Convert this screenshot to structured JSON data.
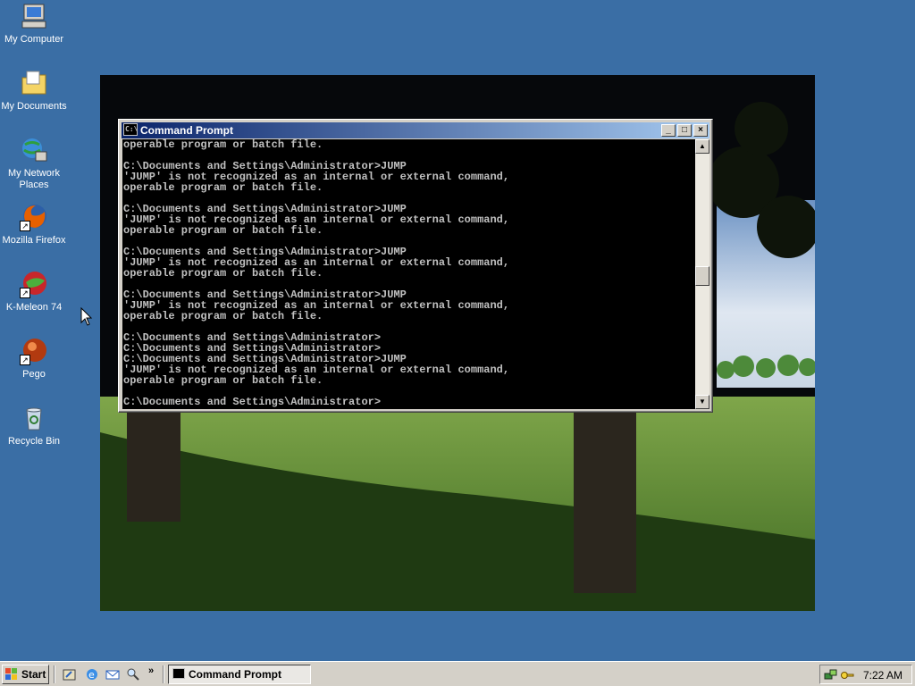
{
  "desktop": {
    "icons": [
      {
        "label": "My Computer",
        "icon": "computer-icon"
      },
      {
        "label": "My Documents",
        "icon": "folder-icon"
      },
      {
        "label": "My Network Places",
        "icon": "network-icon"
      },
      {
        "label": "Mozilla Firefox",
        "icon": "firefox-icon"
      },
      {
        "label": "K-Meleon 74",
        "icon": "kmeleon-icon"
      },
      {
        "label": "Pego",
        "icon": "pego-icon"
      },
      {
        "label": "Recycle Bin",
        "icon": "recycle-bin-icon"
      }
    ]
  },
  "window": {
    "title": "Command Prompt",
    "console_lines": [
      "operable program or batch file.",
      "",
      "C:\\Documents and Settings\\Administrator>JUMP",
      "'JUMP' is not recognized as an internal or external command,",
      "operable program or batch file.",
      "",
      "C:\\Documents and Settings\\Administrator>JUMP",
      "'JUMP' is not recognized as an internal or external command,",
      "operable program or batch file.",
      "",
      "C:\\Documents and Settings\\Administrator>JUMP",
      "'JUMP' is not recognized as an internal or external command,",
      "operable program or batch file.",
      "",
      "C:\\Documents and Settings\\Administrator>JUMP",
      "'JUMP' is not recognized as an internal or external command,",
      "operable program or batch file.",
      "",
      "C:\\Documents and Settings\\Administrator>",
      "C:\\Documents and Settings\\Administrator>",
      "C:\\Documents and Settings\\Administrator>JUMP",
      "'JUMP' is not recognized as an internal or external command,",
      "operable program or batch file.",
      "",
      "C:\\Documents and Settings\\Administrator>"
    ]
  },
  "taskbar": {
    "start_label": "Start",
    "task_label": "Command Prompt",
    "clock": "7:22 AM"
  },
  "colors": {
    "desktop": "#3a6ea5",
    "title_active": "#0a246a",
    "console_bg": "#000000",
    "console_fg": "#c0c0c0"
  }
}
